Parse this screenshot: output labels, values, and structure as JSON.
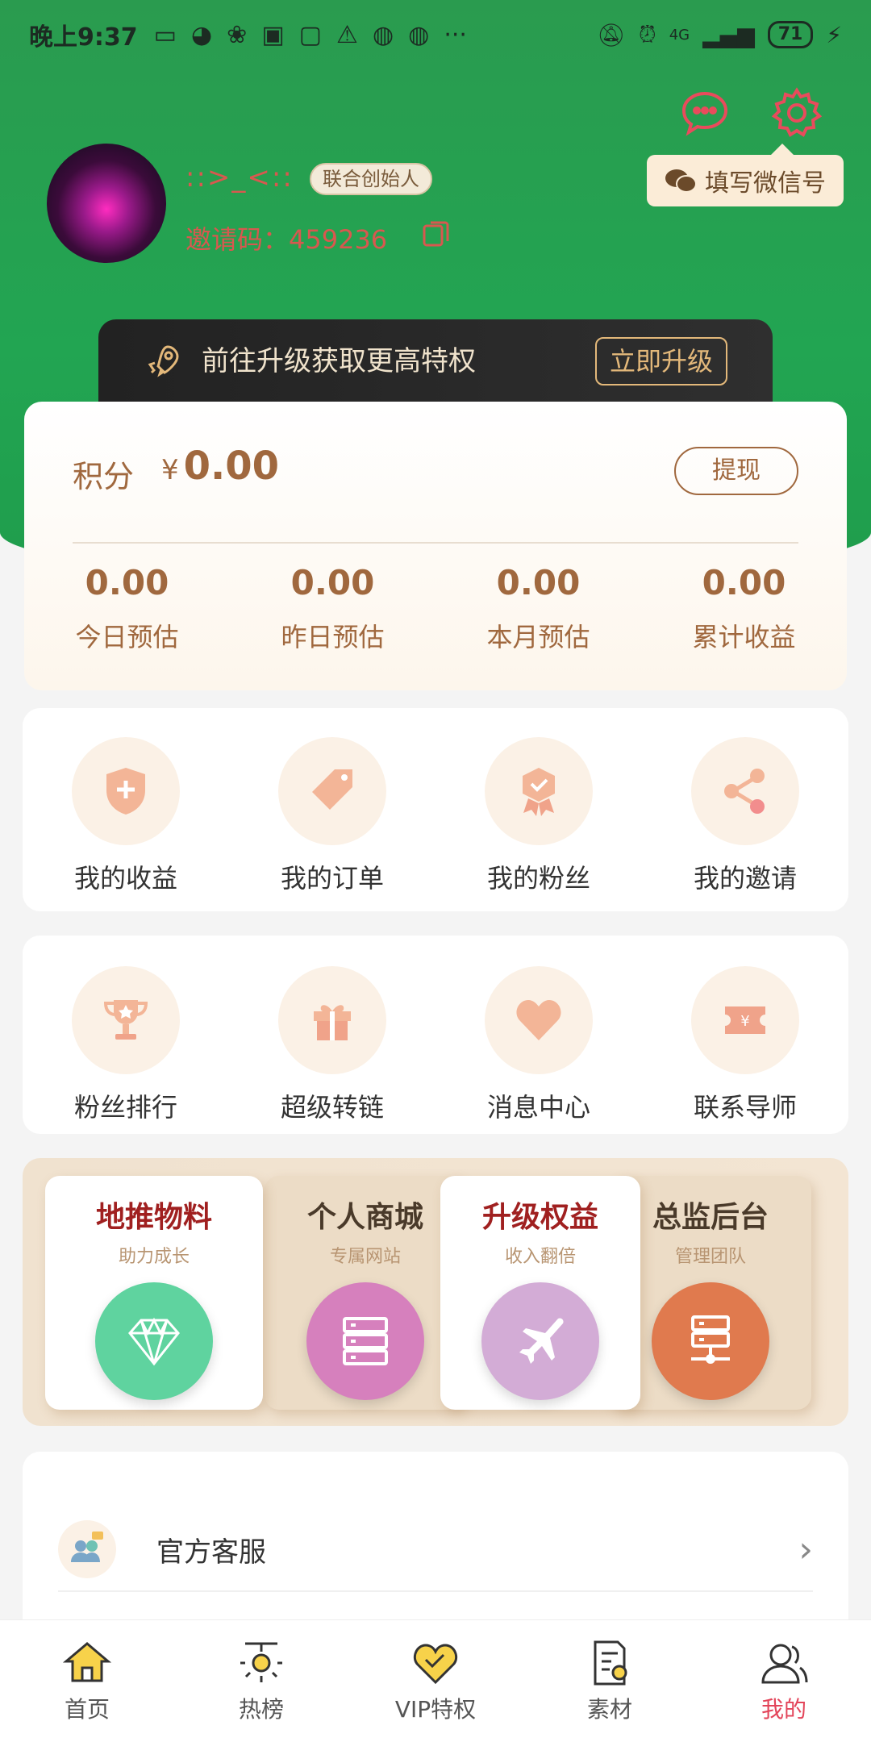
{
  "status_bar": {
    "time": "晚上9:37",
    "more": "···",
    "network": "4G",
    "battery": "71"
  },
  "profile": {
    "nickname": "::>_<::",
    "role_badge": "联合创始人",
    "invite_code": "邀请码：459236",
    "wechat_tip": "填写微信号"
  },
  "upgrade": {
    "text": "前往升级获取更高特权",
    "button": "立即升级"
  },
  "points": {
    "label": "积分",
    "currency": "¥",
    "value": "0.00",
    "withdraw": "提现",
    "stats": [
      {
        "value": "0.00",
        "label": "今日预估"
      },
      {
        "value": "0.00",
        "label": "昨日预估"
      },
      {
        "value": "0.00",
        "label": "本月预估"
      },
      {
        "value": "0.00",
        "label": "累计收益"
      }
    ]
  },
  "grid1": [
    {
      "label": "我的收益",
      "icon": "shield-plus-icon"
    },
    {
      "label": "我的订单",
      "icon": "tag-icon"
    },
    {
      "label": "我的粉丝",
      "icon": "badge-check-icon"
    },
    {
      "label": "我的邀请",
      "icon": "share-icon"
    }
  ],
  "grid2": [
    {
      "label": "粉丝排行",
      "icon": "trophy-icon"
    },
    {
      "label": "超级转链",
      "icon": "gift-icon"
    },
    {
      "label": "消息中心",
      "icon": "heart-icon"
    },
    {
      "label": "联系导师",
      "icon": "ticket-icon"
    }
  ],
  "features": [
    {
      "title": "地推物料",
      "sub": "助力成长",
      "color": "#5fd39f",
      "icon": "diamond-icon"
    },
    {
      "title": "个人商城",
      "sub": "专属网站",
      "color": "#d680bd",
      "icon": "server-stack-icon"
    },
    {
      "title": "升级权益",
      "sub": "收入翻倍",
      "color": "#d3acd6",
      "icon": "airplane-icon"
    },
    {
      "title": "总监后台",
      "sub": "管理团队",
      "color": "#e07a4e",
      "icon": "network-server-icon"
    }
  ],
  "list": [
    {
      "label": "官方客服",
      "icon": "customer-service-icon"
    }
  ],
  "nav": [
    {
      "label": "首页",
      "icon": "home-icon"
    },
    {
      "label": "热榜",
      "icon": "hot-lamp-icon"
    },
    {
      "label": "VIP特权",
      "icon": "vip-heart-icon"
    },
    {
      "label": "素材",
      "icon": "material-doc-icon"
    },
    {
      "label": "我的",
      "icon": "user-icon",
      "active": true
    }
  ],
  "colors": {
    "header_green": "#22a552",
    "accent_brown": "#a0683e",
    "active_nav": "#e3455a"
  }
}
